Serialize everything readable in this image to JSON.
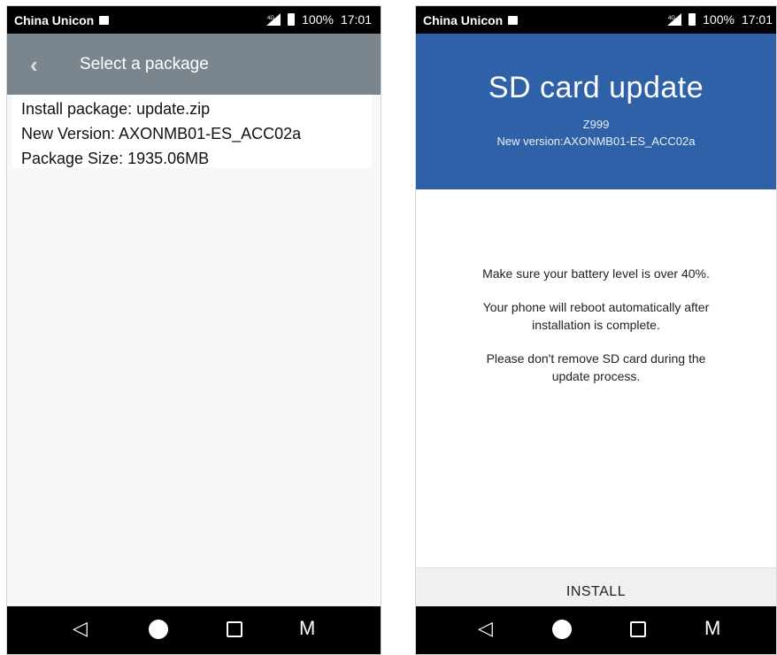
{
  "status_bar": {
    "carrier": "China Unicon",
    "network": "4G",
    "battery": "100%",
    "time": "17:01"
  },
  "left_screen": {
    "title": "Select a package",
    "lines": [
      "Install package: update.zip",
      "New Version: AXONMB01-ES_ACC02a",
      "Package Size: 1935.06MB"
    ]
  },
  "right_screen": {
    "title": "SD card update",
    "model": "Z999",
    "version": "New version:AXONMB01-ES_ACC02a",
    "notes": [
      "Make sure your battery level is over 40%.",
      "Your phone will reboot automatically after installation is complete.",
      "Please don't remove SD card during the update process."
    ],
    "install_label": "INSTALL"
  },
  "nav": {
    "back": "◁",
    "menu": "M"
  },
  "colors": {
    "left_appbar": "#7a858e",
    "hero_blue": "#2e61a8"
  }
}
